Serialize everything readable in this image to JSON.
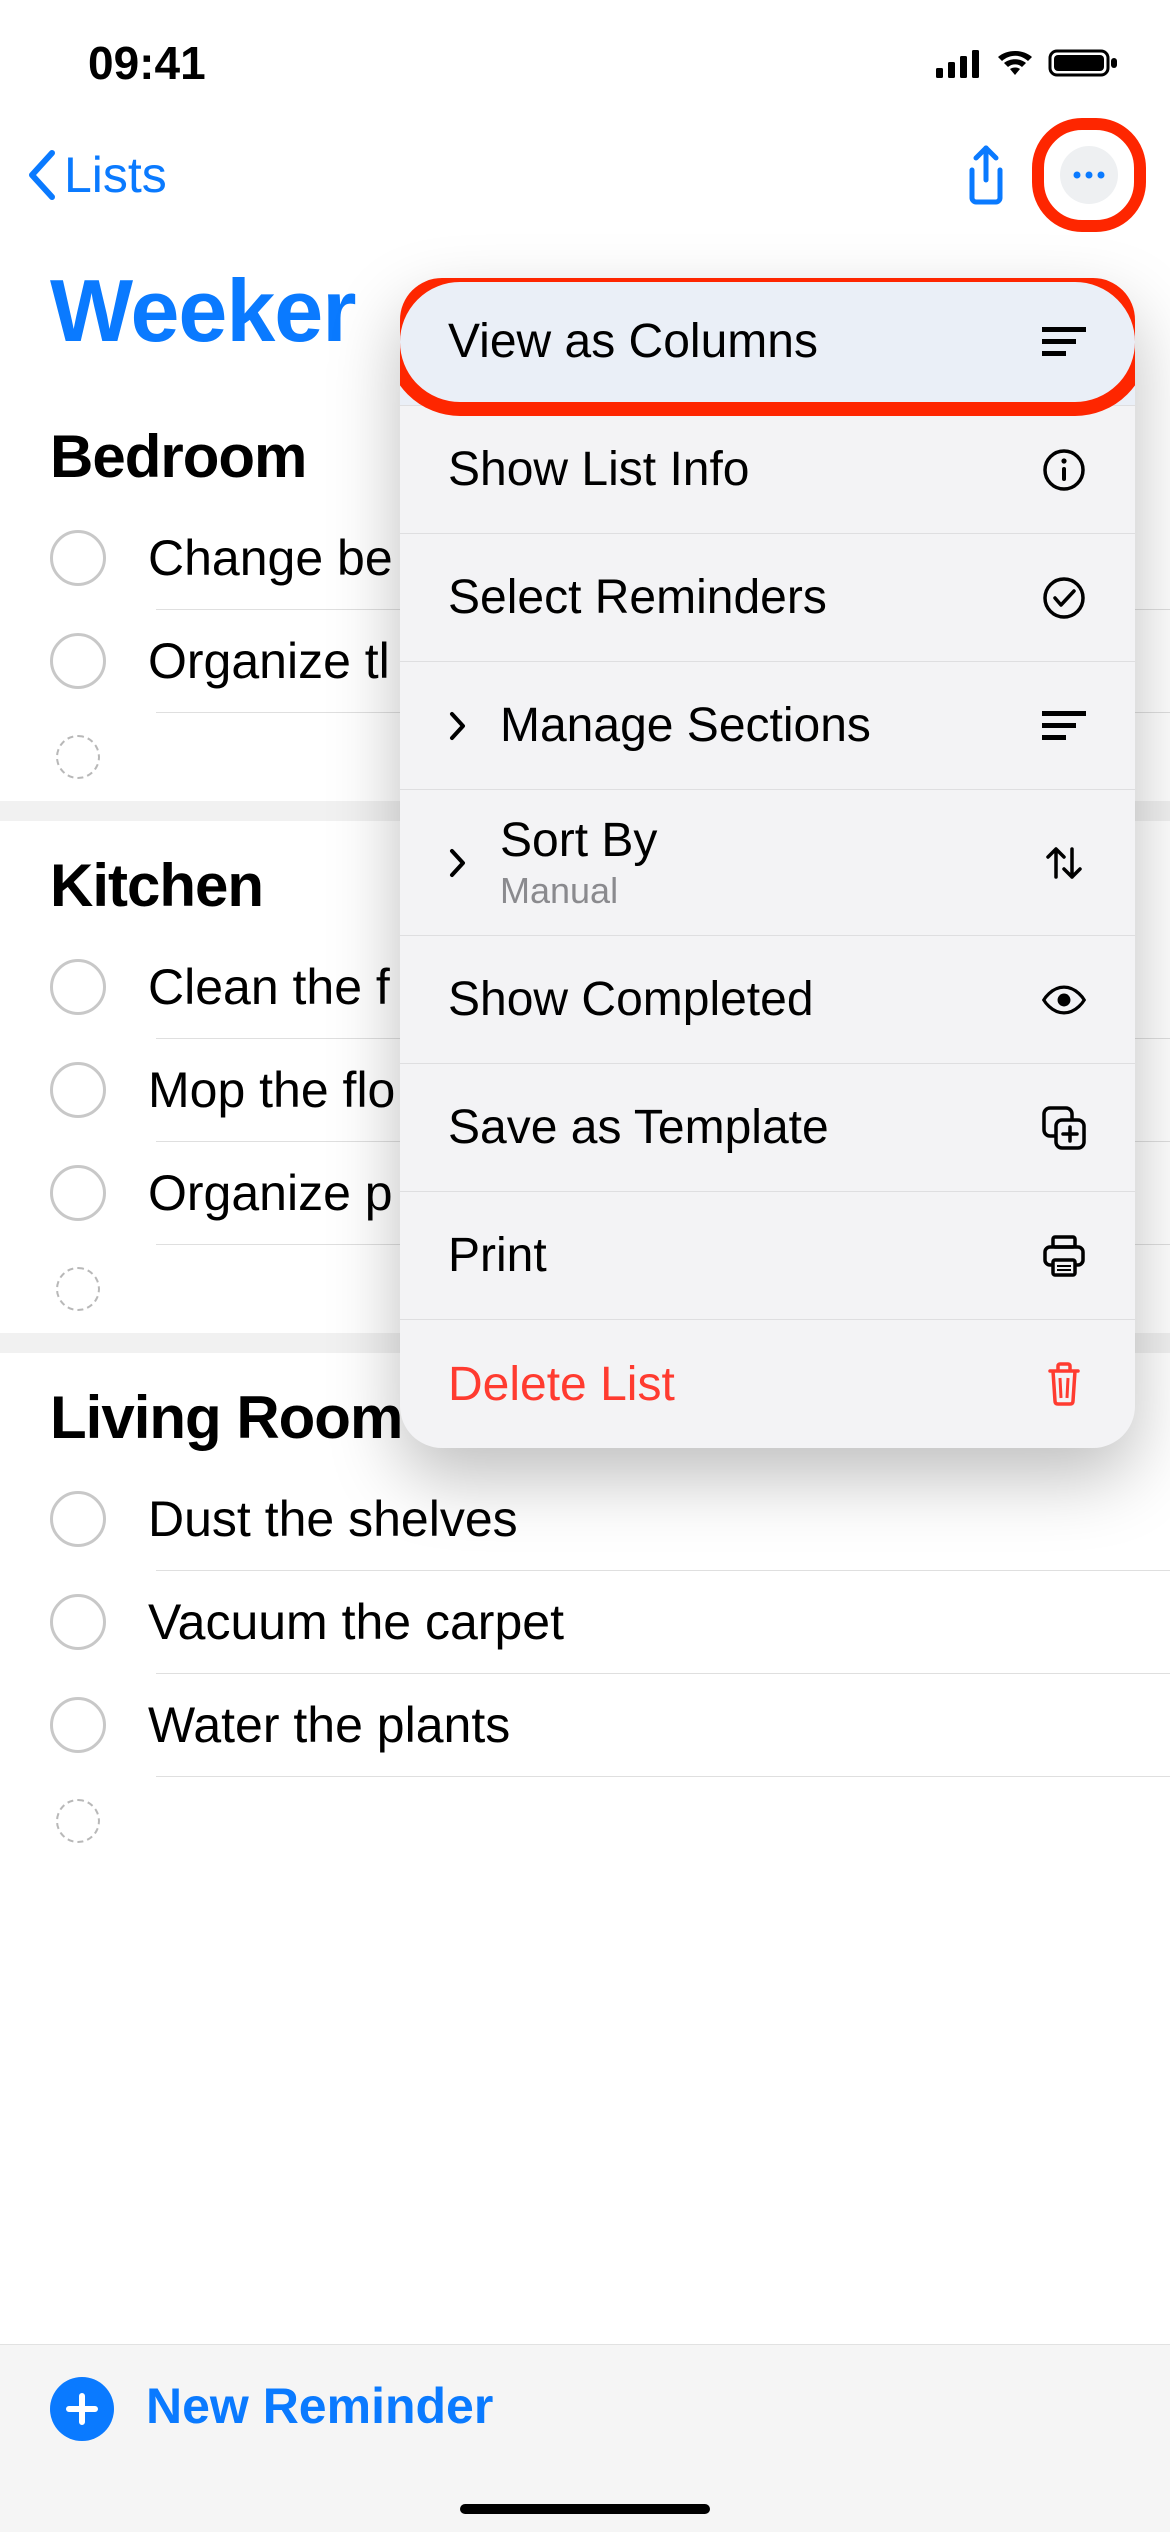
{
  "status": {
    "time": "09:41"
  },
  "nav": {
    "back_label": "Lists"
  },
  "title": "Weeker",
  "sections": [
    {
      "name": "Bedroom",
      "tasks": [
        "Change be",
        "Organize tl"
      ]
    },
    {
      "name": "Kitchen",
      "tasks": [
        "Clean the f",
        "Mop the flo",
        "Organize p"
      ]
    },
    {
      "name": "Living Room",
      "tasks": [
        "Dust the shelves",
        "Vacuum the carpet",
        "Water the plants"
      ]
    }
  ],
  "menu": {
    "items": [
      {
        "label": "View as Columns",
        "icon": "columns",
        "sub": "",
        "chev": false,
        "destructive": false
      },
      {
        "label": "Show List Info",
        "icon": "info",
        "sub": "",
        "chev": false,
        "destructive": false
      },
      {
        "label": "Select Reminders",
        "icon": "check",
        "sub": "",
        "chev": false,
        "destructive": false
      },
      {
        "label": "Manage Sections",
        "icon": "sections",
        "sub": "",
        "chev": true,
        "destructive": false
      },
      {
        "label": "Sort By",
        "icon": "sort",
        "sub": "Manual",
        "chev": true,
        "destructive": false
      },
      {
        "label": "Show Completed",
        "icon": "eye",
        "sub": "",
        "chev": false,
        "destructive": false
      },
      {
        "label": "Save as Template",
        "icon": "template",
        "sub": "",
        "chev": false,
        "destructive": false
      },
      {
        "label": "Print",
        "icon": "print",
        "sub": "",
        "chev": false,
        "destructive": false
      },
      {
        "label": "Delete List",
        "icon": "trash",
        "sub": "",
        "chev": false,
        "destructive": true
      }
    ]
  },
  "bottom": {
    "new_reminder": "New Reminder"
  }
}
